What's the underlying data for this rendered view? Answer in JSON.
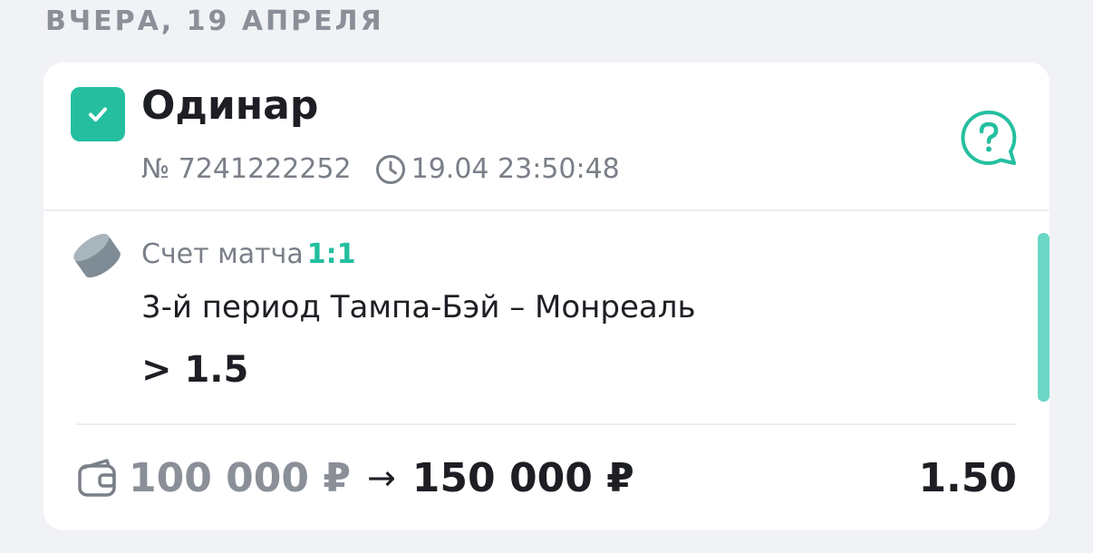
{
  "date_header": "Вчера, 19 апреля",
  "card": {
    "bet_type": "Одинар",
    "bet_number": "№ 7241222252",
    "datetime": "19.04 23:50:48",
    "market_label": "Счет матча",
    "market_score": "1:1",
    "event": "3-й период Тампа-Бэй – Монреаль",
    "outcome": "> 1.5",
    "stake": "100 000 ₽",
    "arrow": "→",
    "payout": "150 000 ₽",
    "odds": "1.50"
  },
  "icons": {
    "status": "check-icon",
    "clock": "clock-icon",
    "help": "help-chat-icon",
    "sport": "hockey-puck-icon",
    "wallet": "wallet-icon"
  },
  "colors": {
    "accent": "#25bfa0",
    "background": "#f1f2f5",
    "card": "#ffffff",
    "muted_text": "#7a7f88",
    "primary_text": "#1d1f24"
  }
}
